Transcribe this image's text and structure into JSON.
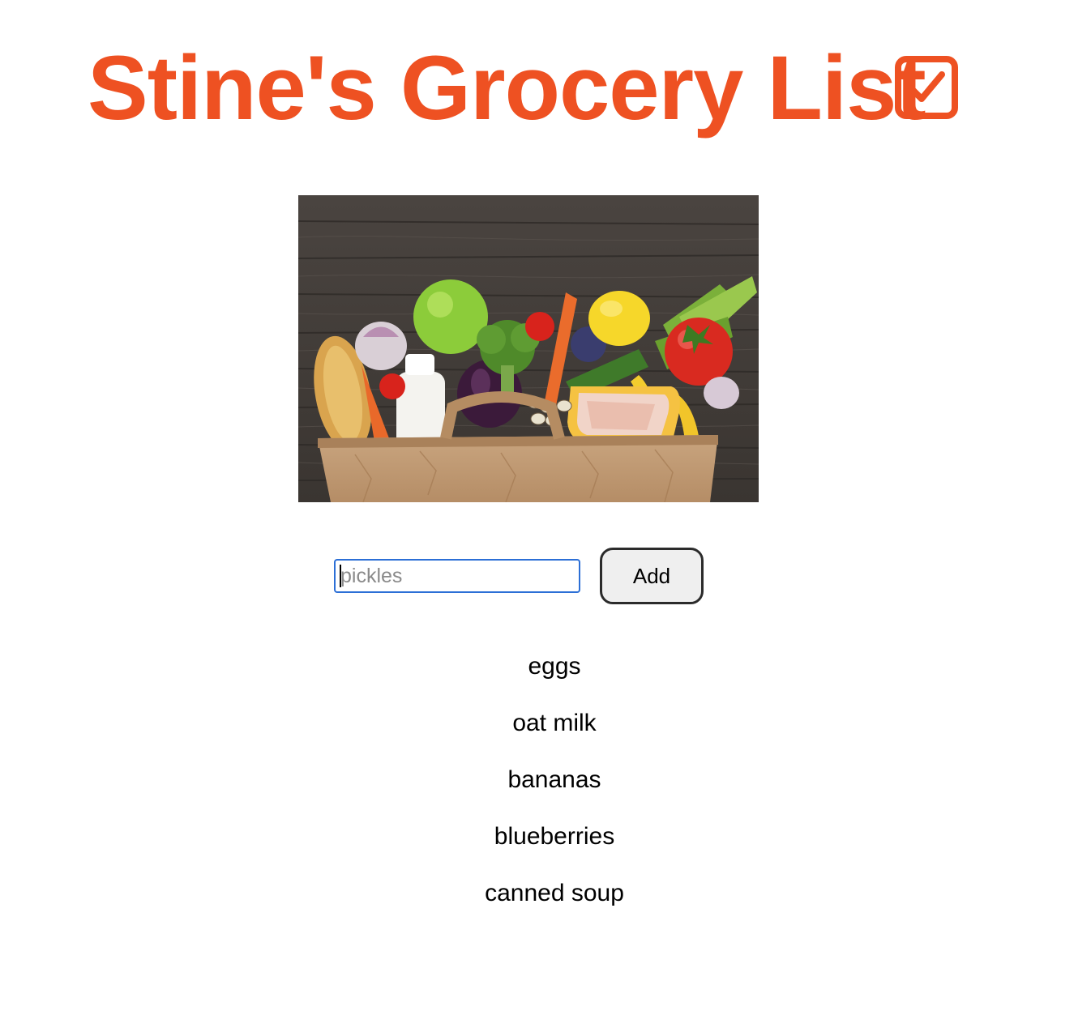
{
  "header": {
    "title": "Stine's Grocery List",
    "accent_color": "#ee5122",
    "title_icon": "checkbox-checked-icon"
  },
  "hero": {
    "image_name": "grocery-bag-image"
  },
  "add_form": {
    "placeholder": "pickles",
    "value": "",
    "button_label": "Add",
    "input_focused": true
  },
  "items": [
    "eggs",
    "oat milk",
    "bananas",
    "blueberries",
    "canned soup"
  ]
}
